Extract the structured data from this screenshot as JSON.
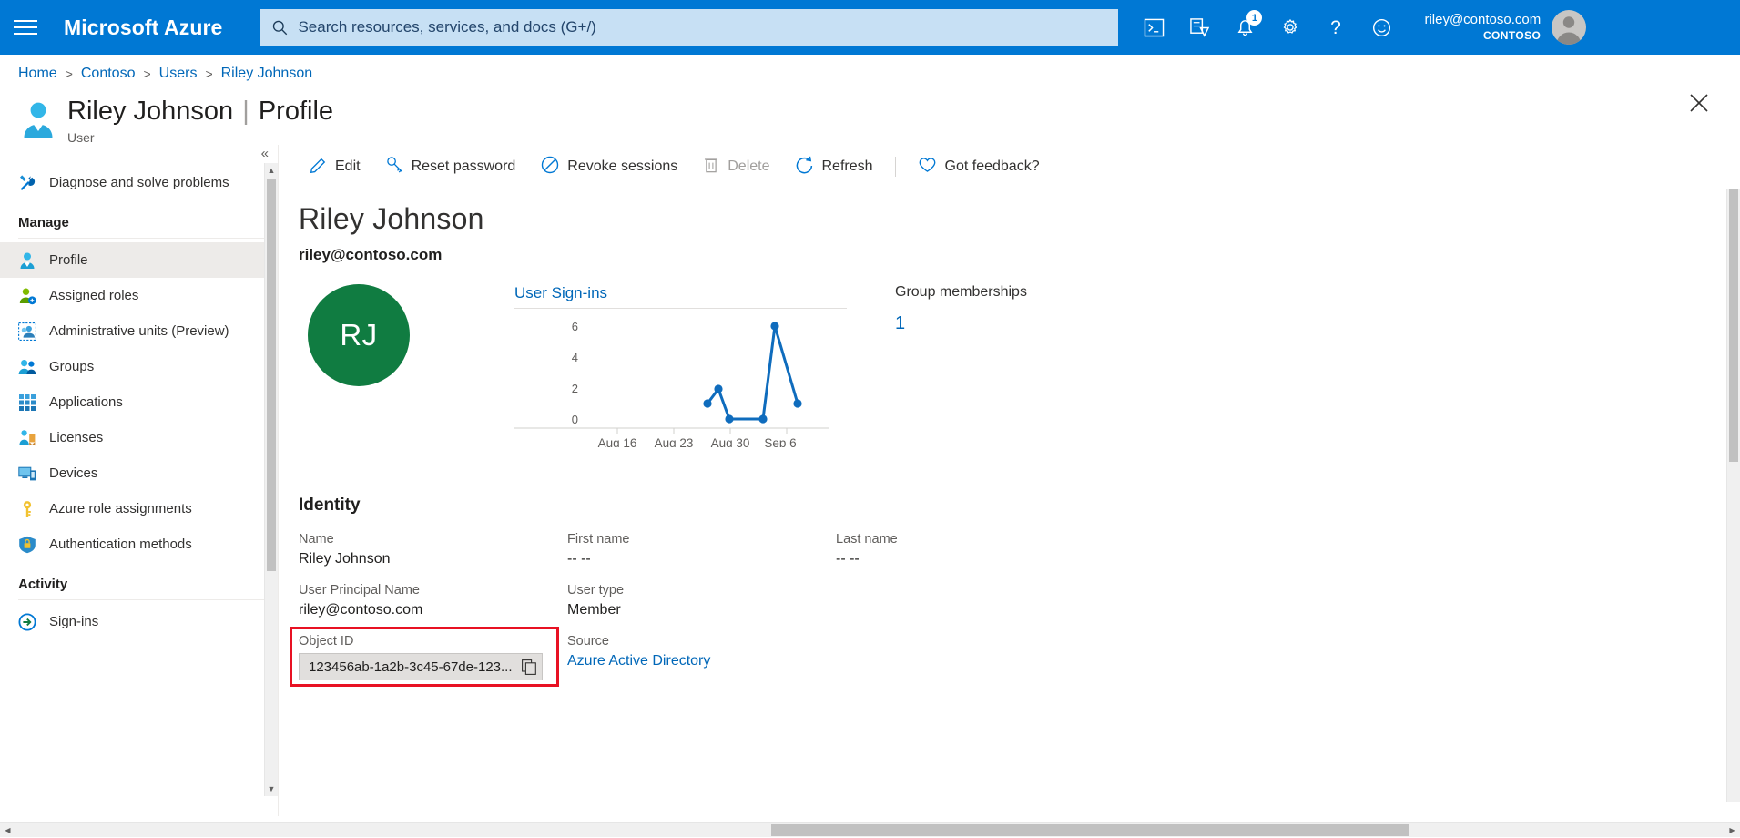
{
  "header": {
    "brand": "Microsoft Azure",
    "menu_icon": "hamburger-icon",
    "search": {
      "placeholder": "Search resources, services, and docs (G+/)",
      "value": "",
      "icon": "search-icon"
    },
    "icons": [
      {
        "name": "cloud-shell-icon",
        "title": "Cloud Shell"
      },
      {
        "name": "directories-subscriptions-icon",
        "title": "Directories + subscriptions"
      },
      {
        "name": "notifications-bell-icon",
        "title": "Notifications",
        "badge": "1"
      },
      {
        "name": "settings-gear-icon",
        "title": "Settings"
      },
      {
        "name": "help-question-icon",
        "title": "Help"
      },
      {
        "name": "feedback-smiley-icon",
        "title": "Feedback"
      }
    ],
    "account": {
      "email": "riley@contoso.com",
      "tenant": "CONTOSO",
      "avatar": "user-avatar-icon"
    },
    "brand_color": "#0078d4",
    "search_bg": "#c7e0f4"
  },
  "breadcrumb": [
    {
      "label": "Home"
    },
    {
      "label": "Contoso"
    },
    {
      "label": "Users"
    },
    {
      "label": "Riley Johnson"
    }
  ],
  "breadcrumb_separator": ">",
  "page": {
    "title_main": "Riley Johnson",
    "title_sep": "|",
    "title_sub": "Profile",
    "subtitle": "User",
    "icon": "user-blue-icon",
    "close_label": "Close"
  },
  "sidebar": {
    "collapse_label": "«",
    "top_items": [
      {
        "label": "Diagnose and solve problems",
        "icon": "wrench-screwdriver-icon",
        "selected": false
      }
    ],
    "groups": [
      {
        "title": "Manage",
        "items": [
          {
            "label": "Profile",
            "icon": "profile-person-icon",
            "selected": true
          },
          {
            "label": "Assigned roles",
            "icon": "assigned-roles-icon",
            "selected": false
          },
          {
            "label": "Administrative units (Preview)",
            "icon": "administrative-units-icon",
            "selected": false
          },
          {
            "label": "Groups",
            "icon": "groups-people-icon",
            "selected": false
          },
          {
            "label": "Applications",
            "icon": "applications-grid-icon",
            "selected": false
          },
          {
            "label": "Licenses",
            "icon": "licenses-badge-icon",
            "selected": false
          },
          {
            "label": "Devices",
            "icon": "devices-monitor-icon",
            "selected": false
          },
          {
            "label": "Azure role assignments",
            "icon": "key-icon",
            "selected": false
          },
          {
            "label": "Authentication methods",
            "icon": "shield-lock-icon",
            "selected": false
          }
        ]
      },
      {
        "title": "Activity",
        "items": [
          {
            "label": "Sign-ins",
            "icon": "sign-ins-arrow-icon",
            "selected": false
          }
        ]
      }
    ]
  },
  "toolbar": {
    "commands": [
      {
        "label": "Edit",
        "icon": "pencil-icon",
        "disabled": false
      },
      {
        "label": "Reset password",
        "icon": "key-icon",
        "disabled": false
      },
      {
        "label": "Revoke sessions",
        "icon": "block-circle-icon",
        "disabled": false
      },
      {
        "label": "Delete",
        "icon": "trash-icon",
        "disabled": true
      },
      {
        "label": "Refresh",
        "icon": "refresh-circle-icon",
        "disabled": false
      }
    ],
    "feedback": {
      "label": "Got feedback?",
      "icon": "heart-icon"
    }
  },
  "overview": {
    "user_name": "Riley Johnson",
    "user_email": "riley@contoso.com",
    "avatar_initials": "RJ",
    "avatar_color": "#107c41",
    "group_memberships": {
      "label": "Group memberships",
      "value": "1"
    }
  },
  "chart_data": {
    "type": "line",
    "title": "User Sign-ins",
    "xlabel": "",
    "ylabel": "",
    "ylim": [
      0,
      7
    ],
    "yticks": [
      0,
      2,
      4,
      6
    ],
    "ytick_labels": [
      "0",
      "2",
      "4",
      "6"
    ],
    "xtick_labels": [
      "Aug 16",
      "Aug 23",
      "Aug 30",
      "Sep 6"
    ],
    "xtick_positions": [
      0.32,
      0.5,
      0.68,
      0.86
    ],
    "grid": false,
    "legend": false,
    "line_color": "#0f6cbd",
    "marker": "circle",
    "x": [
      "Aug 27",
      "Aug 29",
      "Aug 31",
      "Sep 4",
      "Sep 6",
      "Sep 8"
    ],
    "values": [
      1,
      2,
      0,
      0,
      6,
      1
    ],
    "series": [
      {
        "name": "User Sign-ins",
        "values": [
          1,
          2,
          0,
          0,
          6,
          1
        ]
      }
    ]
  },
  "identity": {
    "heading": "Identity",
    "fields": {
      "name": {
        "label": "Name",
        "value": "Riley Johnson"
      },
      "upn": {
        "label": "User Principal Name",
        "value": "riley@contoso.com"
      },
      "object_id": {
        "label": "Object ID",
        "value": "123456ab-1a2b-3c45-67de-123...",
        "copy_icon": "copy-icon",
        "highlight_color": "#e81123"
      },
      "first_name": {
        "label": "First name",
        "value": "-- --"
      },
      "user_type": {
        "label": "User type",
        "value": "Member"
      },
      "source": {
        "label": "Source",
        "value": "Azure Active Directory",
        "is_link": true
      },
      "last_name": {
        "label": "Last name",
        "value": "-- --"
      }
    }
  },
  "scrollbars": {
    "up_arrow": "▲",
    "down_arrow": "▼",
    "left_arrow": "◀",
    "right_arrow": "▶"
  }
}
